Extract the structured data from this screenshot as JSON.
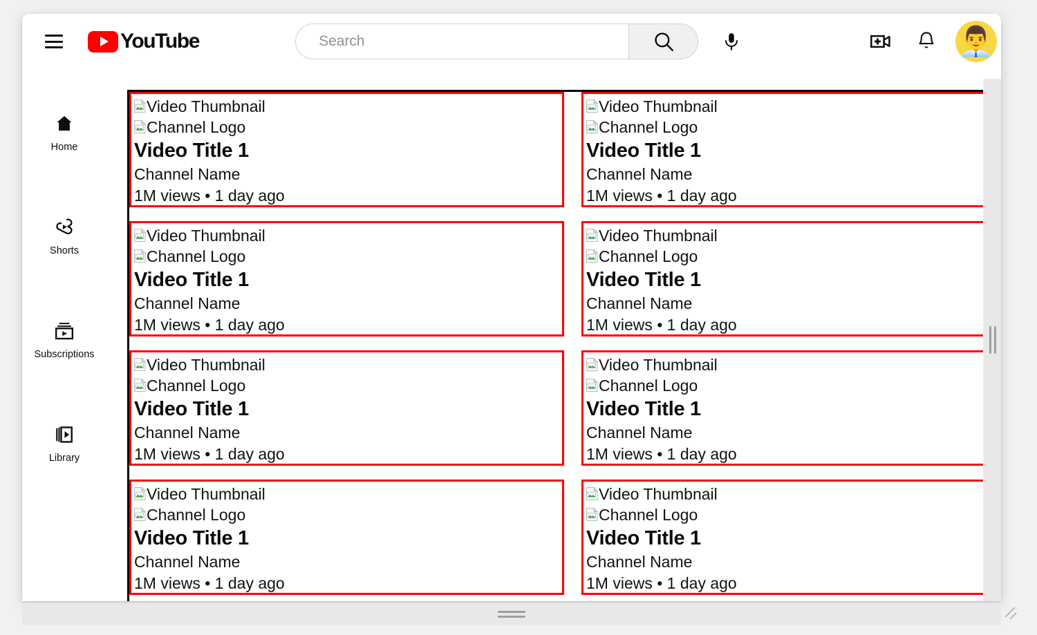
{
  "app": {
    "name": "YouTube",
    "logo_text": "YouTube",
    "brand_color": "#ff0000"
  },
  "topbar": {
    "menu_icon": "hamburger-menu-icon",
    "search": {
      "value": "",
      "placeholder": "Search",
      "button_icon": "search-icon"
    },
    "mic_icon": "microphone-icon",
    "create_icon": "create-video-icon",
    "notifications_icon": "notification-bell-icon",
    "avatar_glyph": "👨‍💼",
    "avatar_bg": "#f8d745"
  },
  "sidebar": {
    "items": [
      {
        "label": "Home",
        "icon": "home-icon"
      },
      {
        "label": "Shorts",
        "icon": "shorts-icon"
      },
      {
        "label": "Subscriptions",
        "icon": "subscriptions-icon"
      },
      {
        "label": "Library",
        "icon": "library-icon"
      }
    ]
  },
  "grid": {
    "card_border_color": "#ff0000",
    "frame_border_color": "#000000",
    "cards": [
      {
        "thumbnail_alt": "Video Thumbnail",
        "channel_logo_alt": "Channel Logo",
        "title": "Video Title 1",
        "channel": "Channel Name",
        "meta": "1M views • 1 day ago"
      },
      {
        "thumbnail_alt": "Video Thumbnail",
        "channel_logo_alt": "Channel Logo",
        "title": "Video Title 1",
        "channel": "Channel Name",
        "meta": "1M views • 1 day ago"
      },
      {
        "thumbnail_alt": "Video Thumbnail",
        "channel_logo_alt": "Channel Logo",
        "title": "Video Title 1",
        "channel": "Channel Name",
        "meta": "1M views • 1 day ago"
      },
      {
        "thumbnail_alt": "Video Thumbnail",
        "channel_logo_alt": "Channel Logo",
        "title": "Video Title 1",
        "channel": "Channel Name",
        "meta": "1M views • 1 day ago"
      },
      {
        "thumbnail_alt": "Video Thumbnail",
        "channel_logo_alt": "Channel Logo",
        "title": "Video Title 1",
        "channel": "Channel Name",
        "meta": "1M views • 1 day ago"
      },
      {
        "thumbnail_alt": "Video Thumbnail",
        "channel_logo_alt": "Channel Logo",
        "title": "Video Title 1",
        "channel": "Channel Name",
        "meta": "1M views • 1 day ago"
      },
      {
        "thumbnail_alt": "Video Thumbnail",
        "channel_logo_alt": "Channel Logo",
        "title": "Video Title 1",
        "channel": "Channel Name",
        "meta": "1M views • 1 day ago"
      },
      {
        "thumbnail_alt": "Video Thumbnail",
        "channel_logo_alt": "Channel Logo",
        "title": "Video Title 1",
        "channel": "Channel Name",
        "meta": "1M views • 1 day ago"
      }
    ]
  },
  "chrome": {
    "vertical_scrollbar": "vertical-scrollbar",
    "horizontal_scrollbar": "horizontal-scrollbar",
    "resize_grip": "resize-grip"
  }
}
